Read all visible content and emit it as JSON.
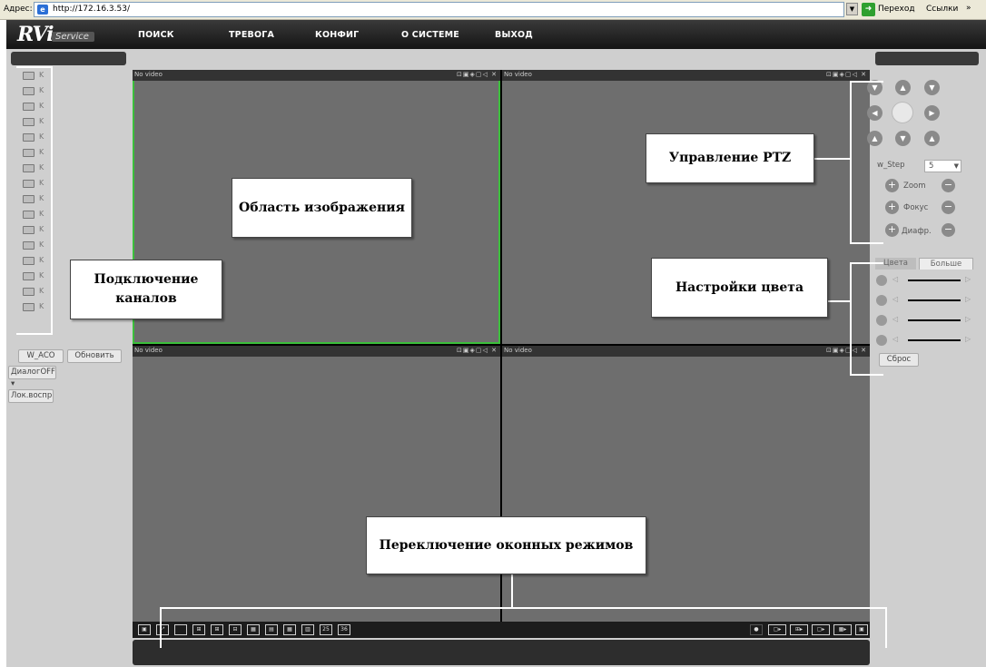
{
  "browser": {
    "address_label": "Адрес:",
    "url": "http://172.16.3.53/",
    "go_label": "Переход",
    "links_label": "Ссылки",
    "chevron": "»"
  },
  "app": {
    "logo_main": "RVi",
    "logo_sub": "Service",
    "nav": [
      "ПОИСК",
      "ТРЕВОГА",
      "КОНФИГ",
      "О СИСТЕМЕ",
      "ВЫХОД"
    ]
  },
  "channels": {
    "item_label": "K",
    "count": 16
  },
  "left_controls": {
    "wacq_button": "W_ACO",
    "refresh_button": "Обновить",
    "dialog_dropdown": "ДиалогOFF",
    "local_playback_button": "Лок.воспр"
  },
  "video": {
    "no_video": "No video",
    "tile_icons": "⊡▣◈▢◁ ✕",
    "toolbar_labels": [
      "25",
      "36"
    ]
  },
  "ptz": {
    "step_label": "w_Step",
    "step_value": "5",
    "zoom_label": "Zoom",
    "focus_label": "Фокус",
    "iris_label": "Диафр."
  },
  "color": {
    "tabs": [
      "Цвета",
      "Больше"
    ],
    "reset_button": "Сброс"
  },
  "callouts": {
    "image_area": "Область изображения",
    "channels": "Подключение каналов",
    "ptz": "Управление PTZ",
    "color": "Настройки цвета",
    "window_modes": "Переключение оконных режимов"
  },
  "colors": {
    "selected_tile": "#3bbf3b",
    "nav_bg": "#1e1e1e",
    "panel_bg": "#cfcfcf",
    "tile_bg": "#6e6e6e"
  }
}
